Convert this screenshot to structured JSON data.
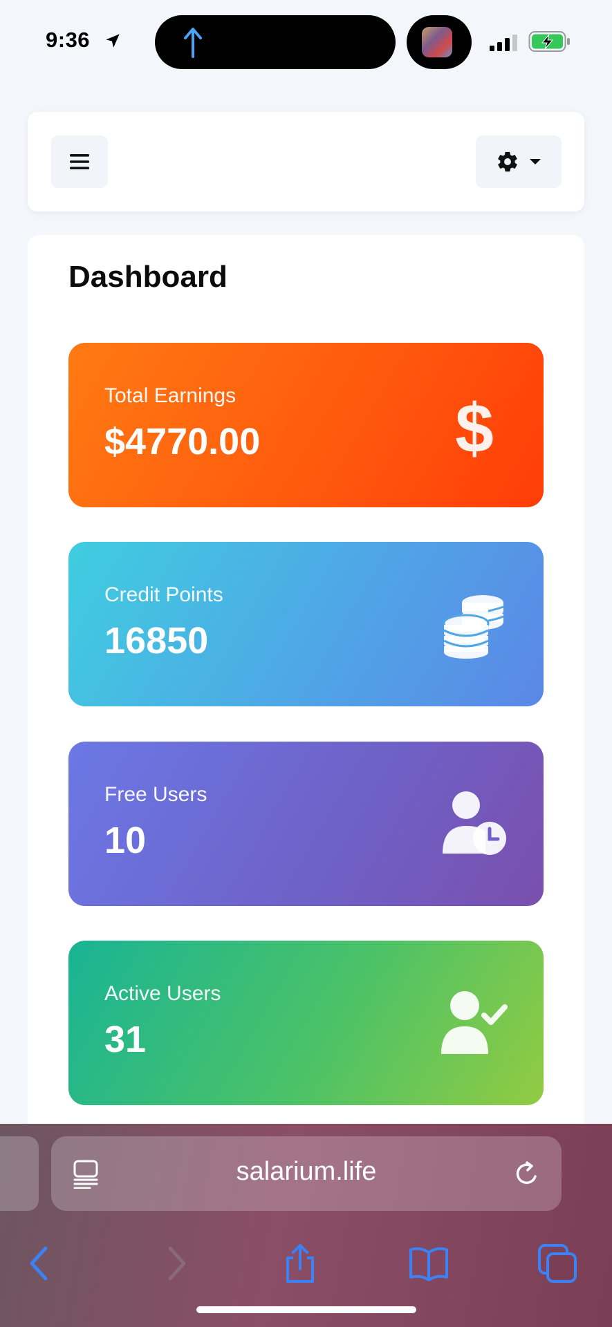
{
  "status_bar": {
    "time": "9:36"
  },
  "header": {
    "menu_icon": "hamburger-menu-icon",
    "settings_icon": "gear-icon",
    "dropdown_icon": "caret-down-icon"
  },
  "dashboard": {
    "title": "Dashboard",
    "cards": [
      {
        "label": "Total Earnings",
        "value": "$4770.00",
        "icon": "dollar-icon",
        "colors": [
          "#ff7a12",
          "#ff3d08"
        ]
      },
      {
        "label": "Credit Points",
        "value": "16850",
        "icon": "coins-icon",
        "colors": [
          "#3fcde0",
          "#5b87e6"
        ]
      },
      {
        "label": "Free Users",
        "value": "10",
        "icon": "user-clock-icon",
        "colors": [
          "#6b78e6",
          "#7a4fae"
        ]
      },
      {
        "label": "Active Users",
        "value": "31",
        "icon": "user-check-icon",
        "colors": [
          "#19b494",
          "#92cb42"
        ]
      }
    ]
  },
  "browser": {
    "url": "salarium.life",
    "accent_color": "#3b82f6"
  }
}
